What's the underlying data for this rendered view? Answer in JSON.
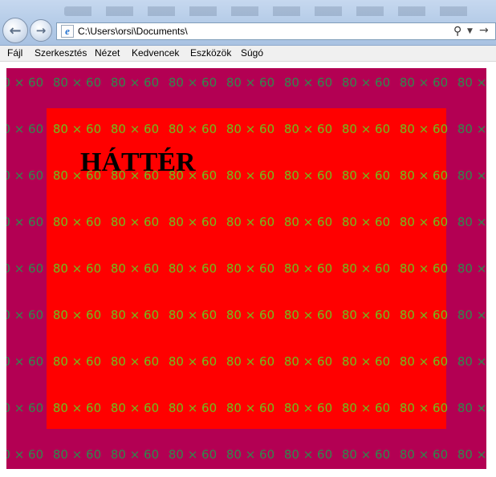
{
  "browser": {
    "address": "C:\\Users\\orsi\\Documents\\",
    "icons": {
      "back": "back-arrow-icon",
      "forward": "forward-arrow-icon",
      "page": "ie-page-icon",
      "search": "search-icon",
      "dropdown": "dropdown-arrow-icon",
      "go": "go-arrow-icon"
    }
  },
  "menu": {
    "items": [
      "Fájl",
      "Szerkesztés",
      "Nézet",
      "Kedvencek",
      "Eszközök",
      "Súgó"
    ]
  },
  "page": {
    "heading": "HÁTTÉR",
    "tile_label": "80 × 60",
    "colors": {
      "outer_background": "#b30053",
      "inner_background": "#ff0000",
      "tile_text_outer": "#2f8a4c",
      "tile_text_inner": "#6fbf1e"
    }
  }
}
